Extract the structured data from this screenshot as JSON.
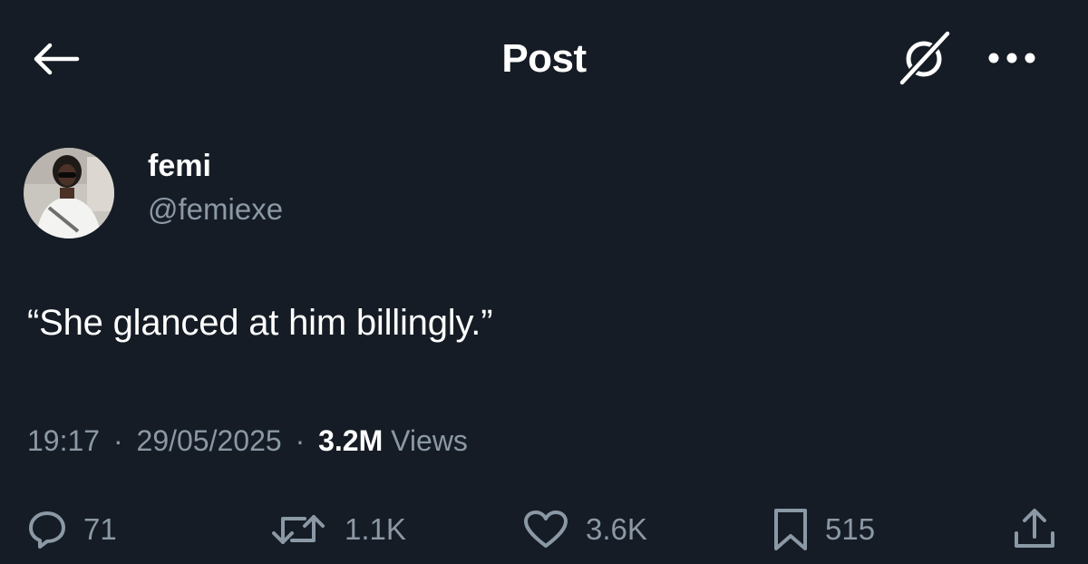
{
  "header": {
    "title": "Post"
  },
  "author": {
    "display_name": "femi",
    "handle": "@femiexe"
  },
  "post": {
    "text": "“She glanced at him billingly.”",
    "time": "19:17",
    "date": "29/05/2025",
    "separator": "·",
    "views_count": "3.2M",
    "views_label": "Views"
  },
  "actions": {
    "replies": "71",
    "reposts": "1.1K",
    "likes": "3.6K",
    "bookmarks": "515"
  },
  "icons": {
    "back": "arrow-left-icon",
    "grok": "grok-icon",
    "more": "more-dots-icon",
    "reply": "reply-bubble-icon",
    "repost": "repost-icon",
    "like": "heart-icon",
    "bookmark": "bookmark-icon",
    "share": "share-icon"
  },
  "colors": {
    "background": "#151c25",
    "text_primary": "#ffffff",
    "text_secondary": "#8b98a5"
  }
}
